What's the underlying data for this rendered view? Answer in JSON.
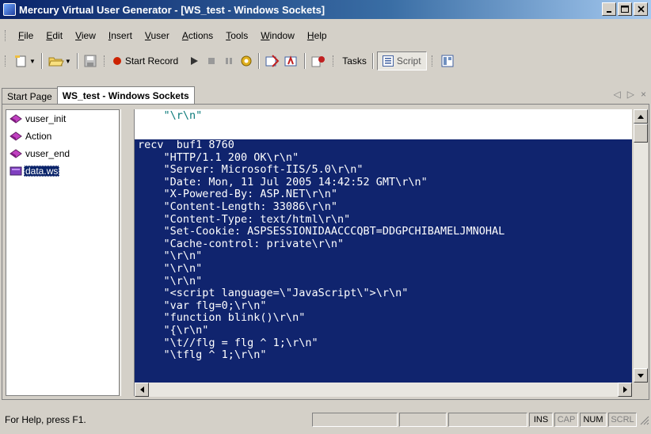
{
  "window": {
    "title": "Mercury Virtual User Generator - [WS_test - Windows Sockets]",
    "app_icon": "vugen-app-icon",
    "buttons": [
      "minimize",
      "maximize",
      "close"
    ]
  },
  "menu": [
    {
      "label": "File"
    },
    {
      "label": "Edit"
    },
    {
      "label": "View"
    },
    {
      "label": "Insert"
    },
    {
      "label": "Vuser"
    },
    {
      "label": "Actions"
    },
    {
      "label": "Tools"
    },
    {
      "label": "Window"
    },
    {
      "label": "Help"
    }
  ],
  "toolbar": {
    "start_record_label": "Start Record",
    "tasks_label": "Tasks",
    "script_label": "Script",
    "icons": [
      "new-icon",
      "open-icon",
      "save-icon",
      "record-icon",
      "play-icon",
      "stop-icon",
      "pause-icon",
      "settings-icon",
      "run-step-icon",
      "compile-icon",
      "help-icon",
      "script-view-icon",
      "layout-icon"
    ]
  },
  "tabs": [
    {
      "label": "Start Page",
      "active": false
    },
    {
      "label": "WS_test - Windows Sockets",
      "active": true
    }
  ],
  "tab_nav": {
    "prev": "◁",
    "next": "▷",
    "close": "×"
  },
  "tree": {
    "items": [
      {
        "label": "vuser_init",
        "selected": false
      },
      {
        "label": "Action",
        "selected": false
      },
      {
        "label": "vuser_end",
        "selected": false
      },
      {
        "label": "data.ws",
        "selected": true
      }
    ]
  },
  "editor": {
    "top_lines": [
      "    \"\\r\\n\""
    ],
    "selected_lines": [
      "recv  buf1 8760",
      "    \"HTTP/1.1 200 OK\\r\\n\"",
      "    \"Server: Microsoft-IIS/5.0\\r\\n\"",
      "    \"Date: Mon, 11 Jul 2005 14:42:52 GMT\\r\\n\"",
      "    \"X-Powered-By: ASP.NET\\r\\n\"",
      "    \"Content-Length: 33086\\r\\n\"",
      "    \"Content-Type: text/html\\r\\n\"",
      "    \"Set-Cookie: ASPSESSIONIDAACCCQBT=DDGPCHIBAMELJMNOHAL",
      "    \"Cache-control: private\\r\\n\"",
      "    \"\\r\\n\"",
      "    \"\\r\\n\"",
      "    \"\\r\\n\"",
      "    \"<script language=\\\"JavaScript\\\">\\r\\n\"",
      "    \"var flg=0;\\r\\n\"",
      "    \"function blink()\\r\\n\"",
      "    \"{\\r\\n\"",
      "    \"\\t//flg = flg ^ 1;\\r\\n\"",
      "    \"\\tflg ^ 1;\\r\\n\""
    ]
  },
  "status": {
    "help_text": "For Help, press F1.",
    "indicators": [
      {
        "label": "",
        "on": true
      },
      {
        "label": "",
        "on": true
      },
      {
        "label": "",
        "on": true
      },
      {
        "label": "INS",
        "on": true
      },
      {
        "label": "CAP",
        "on": false
      },
      {
        "label": "NUM",
        "on": true
      },
      {
        "label": "SCRL",
        "on": false
      }
    ]
  },
  "colors": {
    "selection": "#10246e",
    "code_text": "#0c7a7a",
    "record": "#cc2200"
  }
}
